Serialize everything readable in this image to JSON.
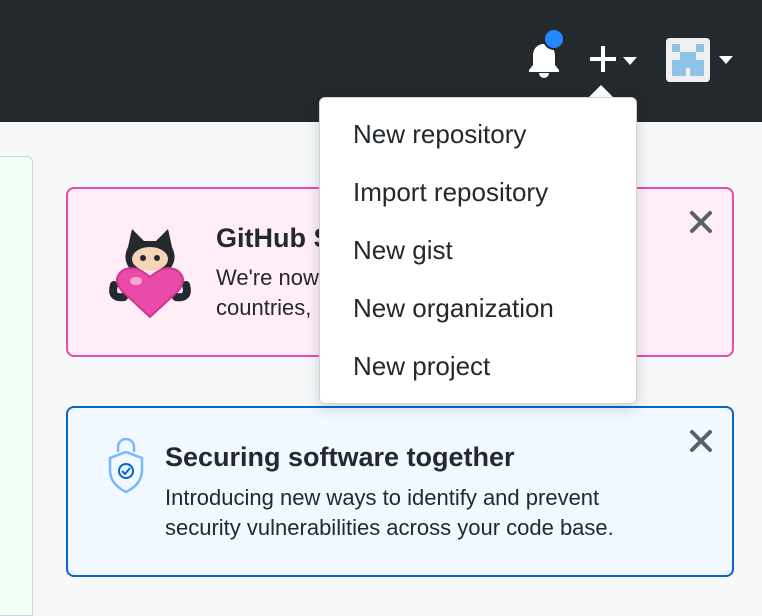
{
  "header": {
    "notifications_icon": "bell-icon",
    "create_icon": "plus-icon",
    "avatar_icon": "identicon-avatar",
    "unread_indicator_color": "#2188ff"
  },
  "create_menu": {
    "items": [
      {
        "label": "New repository"
      },
      {
        "label": "Import repository"
      },
      {
        "label": "New gist"
      },
      {
        "label": "New organization"
      },
      {
        "label": "New project"
      }
    ]
  },
  "sponsors_card": {
    "title": "GitHub S",
    "body_line1": "We're now",
    "body_line2": "countries,",
    "accent_color": "#ea4aaa",
    "icon": "octocat-heart-icon"
  },
  "security_card": {
    "title": "Securing software together",
    "body_line1": "Introducing new ways to identify and prevent",
    "body_line2": "security vulnerabilities across your code base.",
    "accent_color": "#0366d6",
    "icon": "shield-lock-icon"
  }
}
